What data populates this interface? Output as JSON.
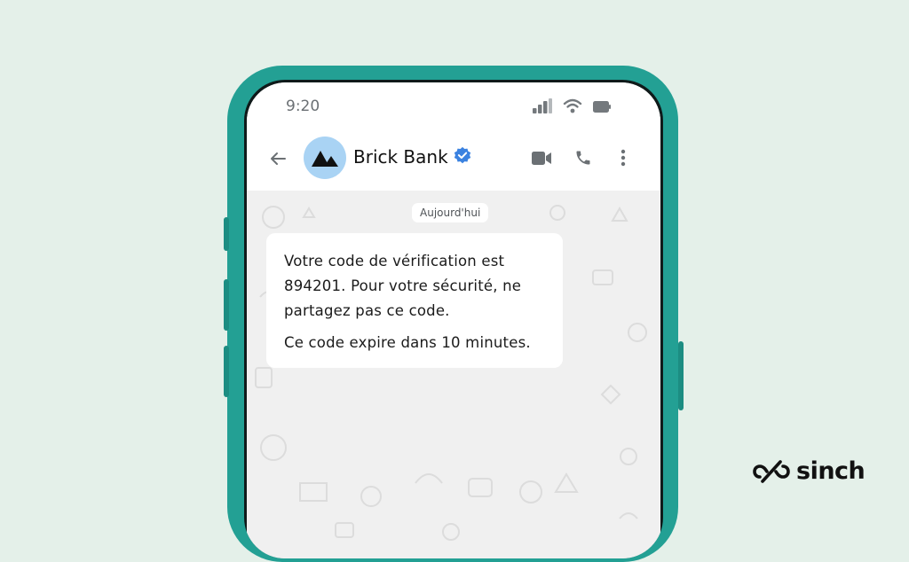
{
  "status_bar": {
    "time": "9:20",
    "icons": [
      "signal-icon",
      "wifi-icon",
      "battery-icon"
    ]
  },
  "chat_header": {
    "back_icon": "arrow-left-icon",
    "contact_name": "Brick Bank",
    "verified_icon": "verified-badge-icon",
    "actions": [
      "video-call-icon",
      "voice-call-icon",
      "more-options-icon"
    ]
  },
  "conversation": {
    "date_label": "Aujourd'hui",
    "message": {
      "paragraph_1": "Votre code de vérification est 894201. Pour votre sécurité, ne partagez pas ce code.",
      "paragraph_2": "Ce code expire dans 10 minutes."
    }
  },
  "brand": {
    "name": "sinch",
    "logo_icon": "sinch-logo-icon"
  },
  "colors": {
    "background": "#e4f0e9",
    "phone_frame": "#23a094",
    "avatar_bg": "#a9d3f4",
    "verified_blue": "#3b82e0",
    "bubble": "#ffffff",
    "chat_bg": "#f0f0f0"
  }
}
